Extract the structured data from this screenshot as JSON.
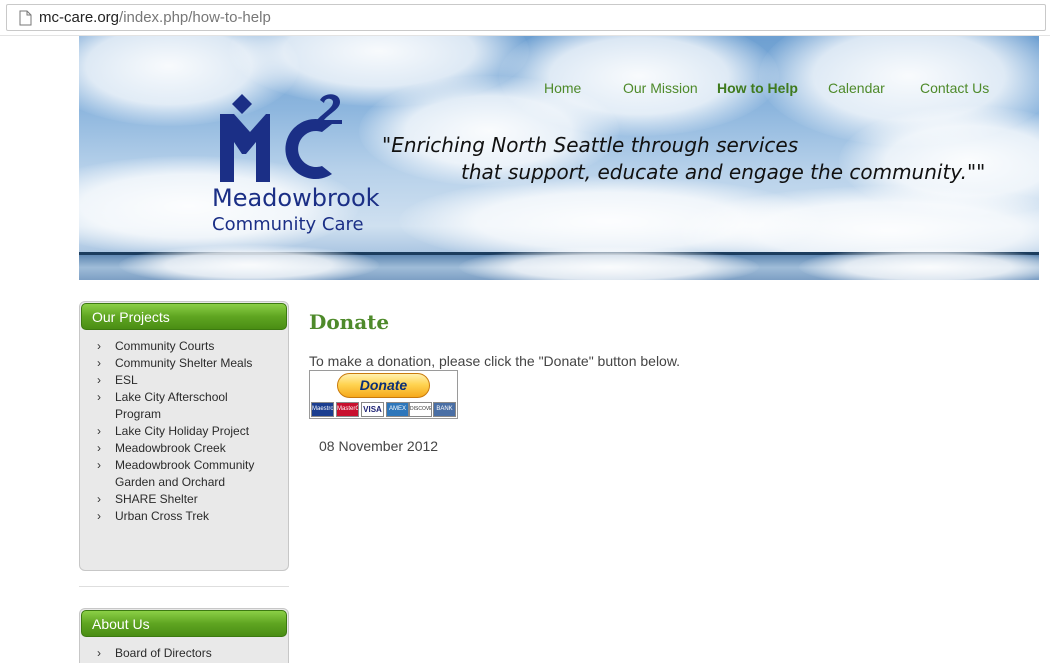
{
  "browser": {
    "url_domain": "mc-care.org",
    "url_path": "/index.php/how-to-help"
  },
  "nav": {
    "items": [
      {
        "label": "Home"
      },
      {
        "label": "Our Mission"
      },
      {
        "label": "How to Help",
        "active": true
      },
      {
        "label": "Calendar"
      },
      {
        "label": "Contact Us"
      }
    ]
  },
  "logo": {
    "line1": "Meadowbrook",
    "line2": "Community Care",
    "mark": "MC",
    "superscript": "2"
  },
  "tagline": {
    "line1": "\"Enriching North Seattle through services",
    "line2": "that support, educate and engage the community.\"\""
  },
  "sidebar": {
    "projects": {
      "heading": "Our Projects",
      "items": [
        {
          "label": "Community Courts"
        },
        {
          "label": "Community Shelter Meals"
        },
        {
          "label": "ESL"
        },
        {
          "label": "Lake City Afterschool Program"
        },
        {
          "label": "Lake City Holiday Project"
        },
        {
          "label": "Meadowbrook Creek"
        },
        {
          "label": "Meadowbrook Community Garden and Orchard"
        },
        {
          "label": "SHARE Shelter"
        },
        {
          "label": "Urban Cross Trek"
        }
      ]
    },
    "about": {
      "heading": "About Us",
      "items": [
        {
          "label": "Board of Directors"
        }
      ]
    }
  },
  "content": {
    "title": "Donate",
    "text": "To make a donation, please click the \"Donate\" button below.",
    "donate_button_label": "Donate",
    "cards": [
      "Maestro",
      "MasterCard",
      "VISA",
      "AMEX",
      "DISCOVER",
      "BANK"
    ],
    "date": "08 November 2012"
  },
  "colors": {
    "accent_green": "#4e8a2a",
    "logo_blue": "#1b2f86",
    "module_head_green": "#5fa521"
  }
}
